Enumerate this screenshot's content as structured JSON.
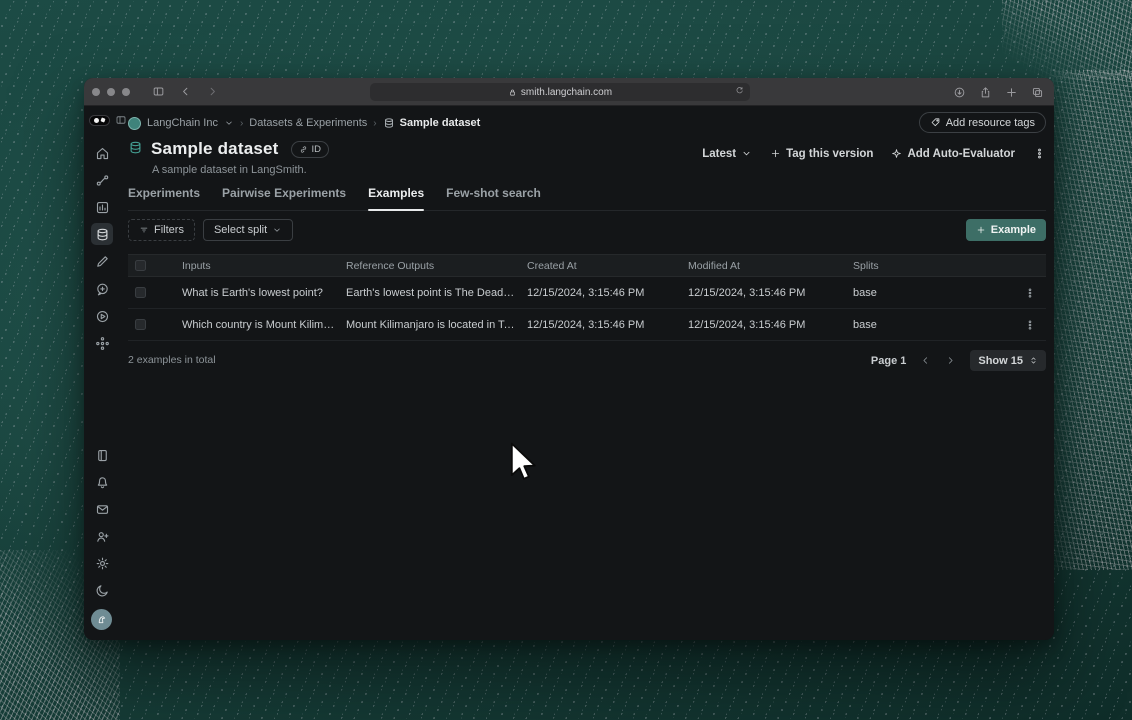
{
  "browser": {
    "url": "smith.langchain.com"
  },
  "breadcrumb": {
    "org": "LangChain Inc",
    "section": "Datasets & Experiments",
    "current": "Sample dataset"
  },
  "header": {
    "title": "Sample dataset",
    "subtitle": "A sample dataset in LangSmith.",
    "id_badge": "ID",
    "add_resource_tags": "Add resource tags",
    "latest": "Latest",
    "tag_this_version": "Tag this version",
    "add_auto_evaluator": "Add Auto-Evaluator"
  },
  "tabs": [
    {
      "label": "Experiments"
    },
    {
      "label": "Pairwise Experiments"
    },
    {
      "label": "Examples"
    },
    {
      "label": "Few-shot search"
    }
  ],
  "active_tab": "Examples",
  "toolbar": {
    "filters": "Filters",
    "select_split": "Select split",
    "add_example": "Example"
  },
  "table": {
    "columns": [
      "Inputs",
      "Reference Outputs",
      "Created At",
      "Modified At",
      "Splits"
    ],
    "rows": [
      {
        "inputs": "What is Earth's lowest point?",
        "reference_outputs": "Earth's lowest point is The Dead Sea.",
        "created_at": "12/15/2024, 3:15:46 PM",
        "modified_at": "12/15/2024, 3:15:46 PM",
        "splits": "base"
      },
      {
        "inputs": "Which country is Mount Kilimanjaro...",
        "reference_outputs": "Mount Kilimanjaro is located in Tanzania.",
        "created_at": "12/15/2024, 3:15:46 PM",
        "modified_at": "12/15/2024, 3:15:46 PM",
        "splits": "base"
      }
    ]
  },
  "footer": {
    "total": "2 examples in total",
    "page": "Page 1",
    "show": "Show 15"
  },
  "colors": {
    "accent_teal": "#3d6e66",
    "page_background": "#1d4a44",
    "app_background": "#131517"
  }
}
